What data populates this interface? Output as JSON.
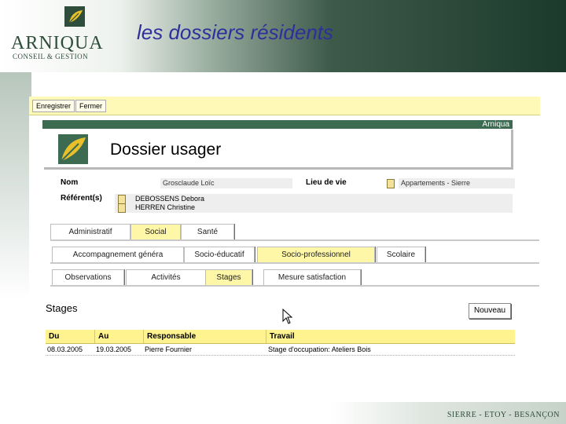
{
  "slide": {
    "title": "les dossiers résidents",
    "brand": {
      "name": "ARNIQUA",
      "tagline": "CONSEIL & GESTION"
    },
    "footer": "SIERRE - ETOY - BESANÇON"
  },
  "app": {
    "toolbar": {
      "save_label": "Enregistrer",
      "close_label": "Fermer"
    },
    "header_brand": "Arniqua",
    "page_title": "Dossier usager",
    "fields": {
      "nom_label": "Nom",
      "nom_value": "Grosclaude Loïc",
      "lieu_label": "Lieu de vie",
      "lieu_value": "Appartements - Sierre",
      "referents_label": "Référent(s)",
      "referents": [
        "DEBOSSENS Debora",
        "HERREN Christine"
      ]
    },
    "tabs_level1": [
      {
        "label": "Administratif",
        "active": false
      },
      {
        "label": "Social",
        "active": true
      },
      {
        "label": "Santé",
        "active": false
      }
    ],
    "tabs_level2": [
      {
        "label": "Accompagnement généra",
        "active": false
      },
      {
        "label": "Socio-éducatif",
        "active": false
      },
      {
        "label": "Socio-professionnel",
        "active": true
      },
      {
        "label": "Scolaire",
        "active": false
      }
    ],
    "tabs_level3": [
      {
        "label": "Observations",
        "active": false
      },
      {
        "label": "Activités",
        "active": false
      },
      {
        "label": "Stages",
        "active": true
      },
      {
        "label": "Mesure satisfaction",
        "active": false
      }
    ],
    "section_title": "Stages",
    "new_button": "Nouveau",
    "table": {
      "columns": [
        "Du",
        "Au",
        "Responsable",
        "Travail"
      ],
      "rows": [
        [
          "08.03.2005",
          "19.03.2005",
          "Pierre Fournier",
          "Stage d'occupation: Ateliers Bois"
        ]
      ]
    }
  },
  "colors": {
    "title": "#2d2f9c",
    "brand_green": "#2f4d3b",
    "toolbar_yellow": "#fff9b8",
    "active_tab": "#fff7a8",
    "table_header": "#fff38f"
  }
}
